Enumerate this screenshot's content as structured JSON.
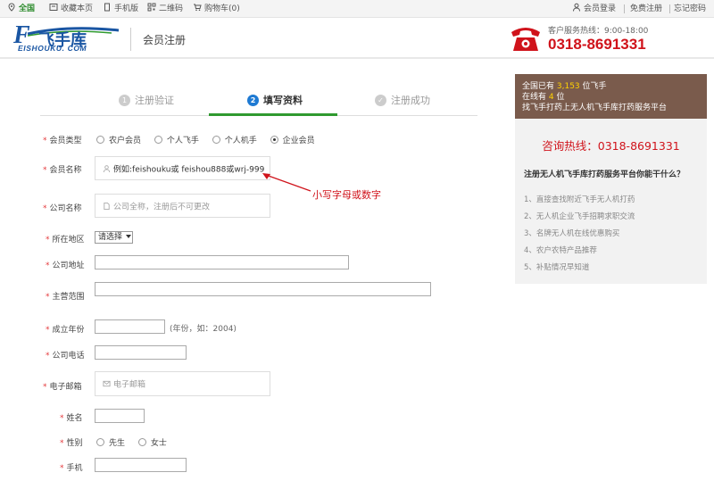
{
  "topbar": {
    "region": "全国",
    "favorite": "收藏本页",
    "mobile": "手机版",
    "qrcode": "二维码",
    "cart": "购物车(0)",
    "login": "会员登录",
    "register": "免费注册",
    "forgot": "忘记密码"
  },
  "header": {
    "logo_text": "飞手库",
    "logo_sub": "EISHOUKU. COM",
    "page_title": "会员注册",
    "hotline_label": "客户服务热线：9:00-18:00",
    "hotline_number": "0318-8691331"
  },
  "steps": [
    {
      "num": "1",
      "label": "注册验证"
    },
    {
      "num": "2",
      "label": "填写资料"
    },
    {
      "num": "✓",
      "label": "注册成功"
    }
  ],
  "form": {
    "member_type": {
      "label": "会员类型",
      "options": [
        "农户会员",
        "个人飞手",
        "个人机手",
        "企业会员"
      ],
      "selected": "企业会员"
    },
    "member_name": {
      "label": "会员名称",
      "placeholder": "例如:feishouku或 feishou888或wrj-999"
    },
    "annotation": "小写字母或数字",
    "company_name": {
      "label": "公司名称",
      "placeholder": "公司全称，注册后不可更改"
    },
    "region": {
      "label": "所在地区",
      "value": "请选择"
    },
    "company_address": {
      "label": "公司地址"
    },
    "business_scope": {
      "label": "主营范围"
    },
    "founded_year": {
      "label": "成立年份",
      "hint": "(年份，如：2004)"
    },
    "company_phone": {
      "label": "公司电话"
    },
    "email": {
      "label": "电子邮箱",
      "placeholder": "电子邮箱"
    },
    "name": {
      "label": "姓名"
    },
    "gender": {
      "label": "性别",
      "options": [
        "先生",
        "女士"
      ]
    },
    "mobile": {
      "label": "手机"
    }
  },
  "sidebar": {
    "stat_prefix": "全国已有",
    "stat_count": "3,153",
    "stat_suffix": "位飞手",
    "online_prefix": "在线有",
    "online_count": "4",
    "online_suffix": "位",
    "slogan": "找飞手打药上无人机飞手库打药服务平台",
    "consult": "咨询热线：0318-8691331",
    "question": "注册无人机飞手库打药服务平台你能干什么？",
    "benefits": [
      "1、直接查找附近飞手无人机打药",
      "2、无人机企业飞手招聘求职交流",
      "3、名牌无人机在线优惠购买",
      "4、农户农特产品推荐",
      "5、补贴情况早知道"
    ]
  },
  "colors": {
    "brand_blue": "#1a56a3",
    "hotline_red": "#d0131b",
    "step_green": "#2f9a2f",
    "sidebar_brown": "#7a5b4c"
  }
}
